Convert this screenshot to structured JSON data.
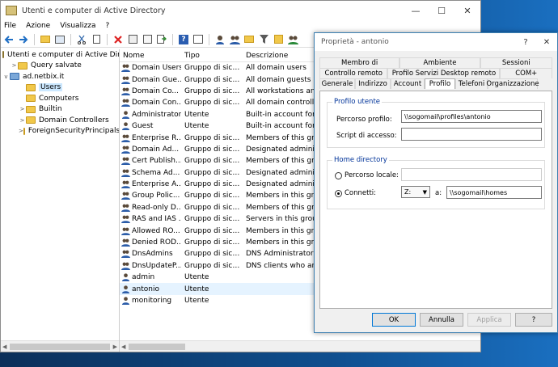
{
  "window": {
    "title": "Utenti e computer di Active Directory",
    "controls": {
      "minimize": "—",
      "maximize": "☐",
      "close": "✕"
    }
  },
  "menu": [
    "File",
    "Azione",
    "Visualizza",
    "?"
  ],
  "tree": [
    {
      "label": "Utenti e computer di Active Direc",
      "indent": 0,
      "icon": "aduc-icon"
    },
    {
      "label": "Query salvate",
      "indent": 1,
      "icon": "folder-icon",
      "expander": ">"
    },
    {
      "label": "ad.netbix.it",
      "indent": 0,
      "icon": "domain-icon",
      "expander": "v"
    },
    {
      "label": "Users",
      "indent": 2,
      "icon": "folder-icon",
      "selected": true
    },
    {
      "label": "Computers",
      "indent": 2,
      "icon": "folder-icon"
    },
    {
      "label": "Builtin",
      "indent": 2,
      "icon": "folder-icon",
      "expander": ">"
    },
    {
      "label": "Domain Controllers",
      "indent": 2,
      "icon": "folder-icon",
      "expander": ">"
    },
    {
      "label": "ForeignSecurityPrincipals",
      "indent": 2,
      "icon": "folder-icon",
      "expander": ">"
    }
  ],
  "list": {
    "headers": {
      "name": "Nome",
      "type": "Tipo",
      "desc": "Descrizione"
    },
    "rows": [
      {
        "name": "Domain Users",
        "type": "Gruppo di sicu...",
        "desc": "All domain users",
        "icon": "group-icon"
      },
      {
        "name": "Domain Gue...",
        "type": "Gruppo di sicu...",
        "desc": "All domain guests",
        "icon": "group-icon"
      },
      {
        "name": "Domain Co...",
        "type": "Gruppo di sicu...",
        "desc": "All workstations and servers",
        "icon": "group-icon"
      },
      {
        "name": "Domain Con...",
        "type": "Gruppo di sicu...",
        "desc": "All domain controllers in the",
        "icon": "group-icon"
      },
      {
        "name": "Administrator",
        "type": "Utente",
        "desc": "Built-in account for administ",
        "icon": "user-icon"
      },
      {
        "name": "Guest",
        "type": "Utente",
        "desc": "Built-in account for guest acc",
        "icon": "user-icon"
      },
      {
        "name": "Enterprise R...",
        "type": "Gruppo di sicu...",
        "desc": "Members of this group are Re",
        "icon": "group-icon"
      },
      {
        "name": "Domain Ad...",
        "type": "Gruppo di sicu...",
        "desc": "Designated administrators of",
        "icon": "group-icon"
      },
      {
        "name": "Cert Publish...",
        "type": "Gruppo di sicu...",
        "desc": "Members of this group are pe",
        "icon": "group-icon"
      },
      {
        "name": "Schema Ad...",
        "type": "Gruppo di sicu...",
        "desc": "Designated administrators of",
        "icon": "group-icon"
      },
      {
        "name": "Enterprise A...",
        "type": "Gruppo di sicu...",
        "desc": "Designated administrators of",
        "icon": "group-icon"
      },
      {
        "name": "Group Polic...",
        "type": "Gruppo di sicu...",
        "desc": "Members in this group can m",
        "icon": "group-icon"
      },
      {
        "name": "Read-only D...",
        "type": "Gruppo di sicu...",
        "desc": "Members of this group are Re",
        "icon": "group-icon"
      },
      {
        "name": "RAS and IAS ...",
        "type": "Gruppo di sicu...",
        "desc": "Servers in this group can acc",
        "icon": "group-icon"
      },
      {
        "name": "Allowed RO...",
        "type": "Gruppo di sicu...",
        "desc": "Members in this group can h",
        "icon": "group-icon"
      },
      {
        "name": "Denied ROD...",
        "type": "Gruppo di sicu...",
        "desc": "Members in this group canno",
        "icon": "group-icon"
      },
      {
        "name": "DnsAdmins",
        "type": "Gruppo di sicu...",
        "desc": "DNS Administrators Group",
        "icon": "group-icon"
      },
      {
        "name": "DnsUpdateP...",
        "type": "Gruppo di sicu...",
        "desc": "DNS clients who are permitte",
        "icon": "group-icon"
      },
      {
        "name": "admin",
        "type": "Utente",
        "desc": "",
        "icon": "user-icon"
      },
      {
        "name": "antonio",
        "type": "Utente",
        "desc": "",
        "icon": "user-icon",
        "selected": true
      },
      {
        "name": "monitoring",
        "type": "Utente",
        "desc": "",
        "icon": "user-icon"
      }
    ]
  },
  "dialog": {
    "title": "Proprietà - antonio",
    "help": "?",
    "close": "✕",
    "tabs_row1": [
      "Membro di",
      "Ambiente",
      "Sessioni"
    ],
    "tabs_row2": [
      "Controllo remoto",
      "Profilo Servizi Desktop remoto",
      "COM+"
    ],
    "tabs_row3": [
      "Generale",
      "Indirizzo",
      "Account",
      "Profilo",
      "Telefoni",
      "Organizzazione"
    ],
    "active_tab": "Profilo",
    "profile_group": {
      "legend": "Profilo utente",
      "path_label": "Percorso profilo:",
      "path_value": "\\\\sogomail\\profiles\\antonio",
      "script_label": "Script di accesso:",
      "script_value": ""
    },
    "home_group": {
      "legend": "Home directory",
      "local_label": "Percorso locale:",
      "local_value": "",
      "connect_label": "Connetti:",
      "drive": "Z:",
      "to_label": "a:",
      "to_value": "\\\\sogomail\\homes",
      "selected": "connect"
    },
    "buttons": {
      "ok": "OK",
      "cancel": "Annulla",
      "apply": "Applica",
      "help": "?"
    }
  }
}
